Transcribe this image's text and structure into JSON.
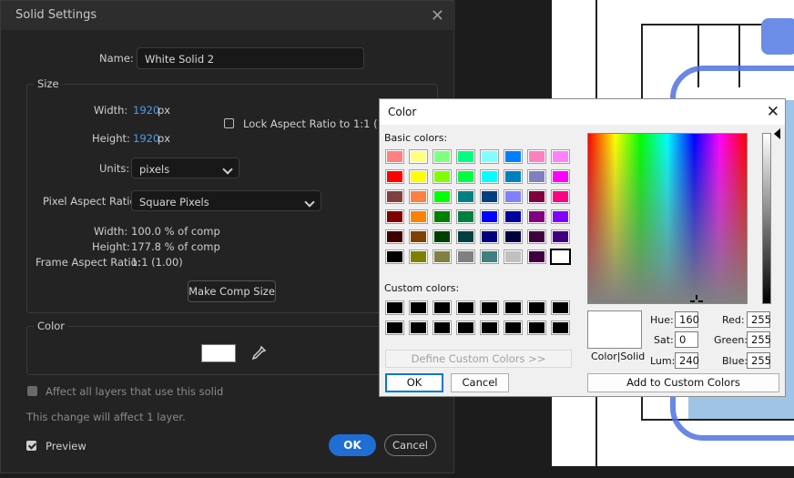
{
  "solid_settings": {
    "title": "Solid Settings",
    "name_label": "Name:",
    "name_value": "White Solid 2",
    "size_group": "Size",
    "width_label": "Width:",
    "width_value": "1920",
    "height_label": "Height:",
    "height_value": "1920",
    "px_unit": "px",
    "lock_aspect_label": "Lock Aspect Ratio to 1:1 (1.00)",
    "units_label": "Units:",
    "units_value": "pixels",
    "pixel_aspect_label": "Pixel Aspect Ratio:",
    "pixel_aspect_value": "Square Pixels",
    "comp_width_label": "Width:",
    "comp_width_value": "100.0 % of comp",
    "comp_height_label": "Height:",
    "comp_height_value": "177.8 % of comp",
    "frame_aspect_label": "Frame Aspect Ratio:",
    "frame_aspect_value": "1:1 (1.00)",
    "make_comp_size": "Make Comp Size",
    "color_group": "Color",
    "affect_all_label": "Affect all layers that use this solid",
    "affect_note": "This change will affect 1 layer.",
    "preview_label": "Preview",
    "ok_label": "OK",
    "cancel_label": "Cancel",
    "swatch_color": "#ffffff"
  },
  "color_dialog": {
    "title": "Color",
    "basic_colors_label": "Basic colors:",
    "basic_colors": [
      [
        "#ff8080",
        "#ffff80",
        "#80ff80",
        "#00ff80",
        "#80ffff",
        "#0080ff",
        "#ff80c0",
        "#ff80ff"
      ],
      [
        "#ff0000",
        "#ffff00",
        "#80ff00",
        "#00ff40",
        "#00ffff",
        "#0080c0",
        "#8080c0",
        "#ff00ff"
      ],
      [
        "#804040",
        "#ff8040",
        "#00ff00",
        "#008080",
        "#004080",
        "#8080ff",
        "#800040",
        "#ff0080"
      ],
      [
        "#800000",
        "#ff8000",
        "#008000",
        "#008040",
        "#0000ff",
        "#0000a0",
        "#800080",
        "#8000ff"
      ],
      [
        "#400000",
        "#804000",
        "#004000",
        "#004040",
        "#000080",
        "#000040",
        "#400040",
        "#400080"
      ],
      [
        "#000000",
        "#808000",
        "#808040",
        "#808080",
        "#408080",
        "#c0c0c0",
        "#400040",
        "#ffffff"
      ]
    ],
    "custom_colors_label": "Custom colors:",
    "custom_colors": [
      [
        "#000000",
        "#000000",
        "#000000",
        "#000000",
        "#000000",
        "#000000",
        "#000000",
        "#000000"
      ],
      [
        "#000000",
        "#000000",
        "#000000",
        "#000000",
        "#000000",
        "#000000",
        "#000000",
        "#000000"
      ]
    ],
    "define_custom": "Define Custom Colors >>",
    "ok_label": "OK",
    "cancel_label": "Cancel",
    "preview_label": "Color|Solid",
    "hue_label": "Hue:",
    "hue_value": "160",
    "sat_label": "Sat:",
    "sat_value": "0",
    "lum_label": "Lum:",
    "lum_value": "240",
    "red_label": "Red:",
    "red_value": "255",
    "green_label": "Green:",
    "green_value": "255",
    "blue_label": "Blue:",
    "blue_value": "255",
    "add_custom": "Add to Custom Colors"
  }
}
